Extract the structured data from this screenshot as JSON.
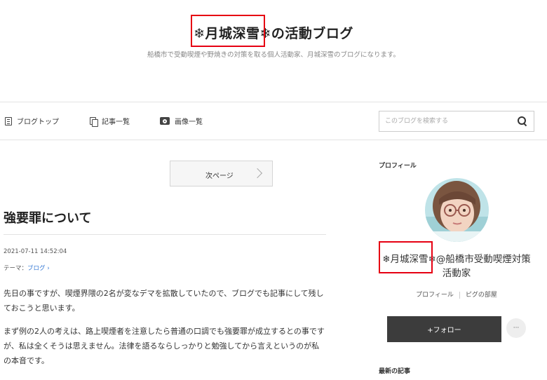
{
  "header": {
    "title_mark": "❄月城深雪",
    "title_rest": "❄の活動ブログ",
    "description": "船橋市で受動喫煙や野焼きの対策を取る個人活動家、月城深雪のブログになります。"
  },
  "nav": {
    "items": [
      {
        "label": "ブログトップ",
        "icon": "list-icon"
      },
      {
        "label": "記事一覧",
        "icon": "copy-icon"
      },
      {
        "label": "画像一覧",
        "icon": "camera-icon"
      }
    ],
    "search_placeholder": "このブログを検索する"
  },
  "pager": {
    "next_label": "次ページ"
  },
  "post": {
    "title": "強要罪について",
    "date": "2021-07-11 14:52:04",
    "theme_label": "テーマ：",
    "theme_value": "ブログ ›",
    "paragraphs": [
      "先日の事ですが、喫煙界隈の2名が変なデマを拡散していたので、ブログでも記事にして残しておこうと思います。",
      "まず例の2人の考えは、路上喫煙者を注意したら普通の口調でも強要罪が成立するとの事ですが、私は全くそうは思えません。法律を語るならしっかりと勉強してから言えというのが私の本音です。"
    ]
  },
  "sidebar": {
    "profile_heading": "プロフィール",
    "profile_name": "❄月城深雪❄@船橋市受動喫煙対策活動家",
    "links": [
      "プロフィール",
      "ピグの部屋"
    ],
    "follow_label": "+フォロー",
    "more_label": "···",
    "recent_heading": "最新の記事"
  },
  "colors": {
    "highlight_box": "#e60012",
    "follow_bg": "#3c3c3c",
    "link": "#3a7bd5"
  }
}
